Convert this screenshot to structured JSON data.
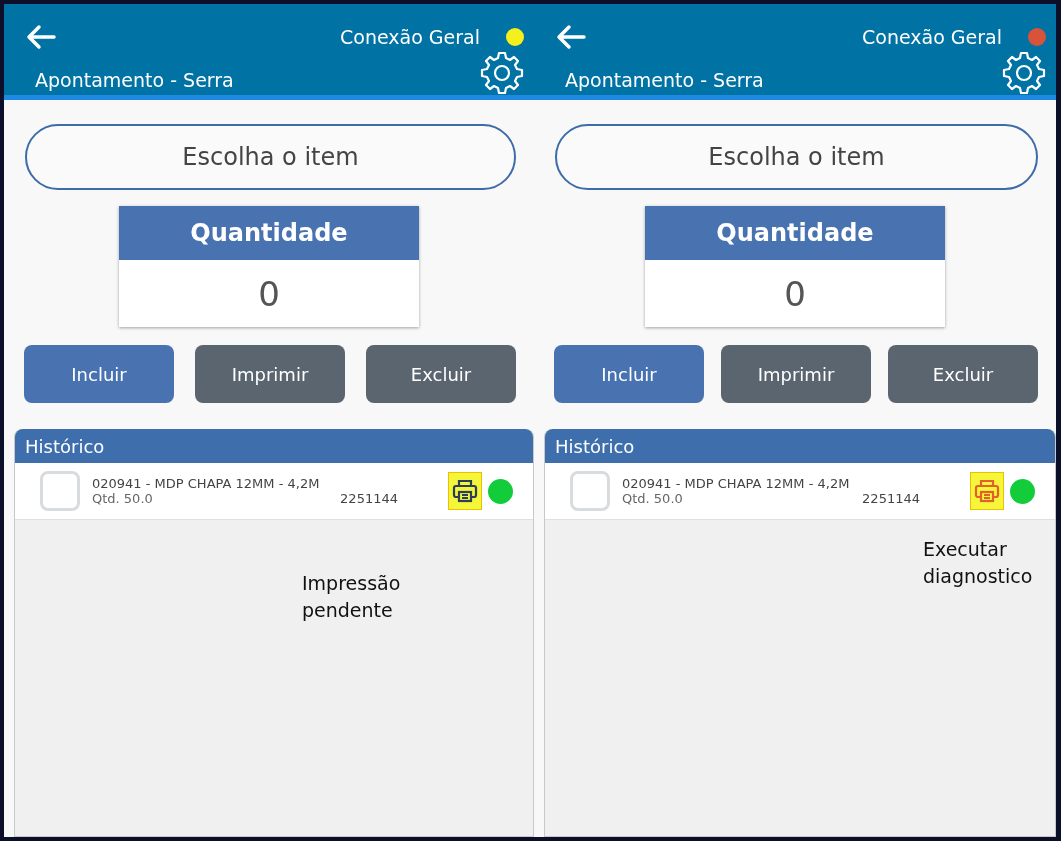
{
  "screens": [
    {
      "header": {
        "connection_label": "Conexão Geral",
        "connection_status": {
          "color": "#f5f01c"
        },
        "title": "Apontamento - Serra"
      },
      "item_picker": {
        "label": "Escolha o item"
      },
      "quantity": {
        "title": "Quantidade",
        "value": "0"
      },
      "buttons": [
        {
          "label": "Incluir",
          "kind": "primary"
        },
        {
          "label": "Imprimir",
          "kind": "secondary"
        },
        {
          "label": "Excluir",
          "kind": "secondary"
        }
      ],
      "history": {
        "title": "Histórico",
        "rows": [
          {
            "checked": false,
            "description": "020941 - MDP CHAPA 12MM - 4,2M",
            "quantity": "Qtd. 50.0",
            "number": "2251144",
            "printer": {
              "color": "#2c3e5a"
            },
            "status": {
              "color": "#13cc3a"
            }
          }
        ]
      },
      "note": "Impressão pendente"
    },
    {
      "header": {
        "connection_label": "Conexão Geral",
        "connection_status": {
          "color": "#d9533a"
        },
        "title": "Apontamento - Serra"
      },
      "item_picker": {
        "label": "Escolha o item"
      },
      "quantity": {
        "title": "Quantidade",
        "value": "0"
      },
      "buttons": [
        {
          "label": "Incluir",
          "kind": "primary"
        },
        {
          "label": "Imprimir",
          "kind": "secondary"
        },
        {
          "label": "Excluir",
          "kind": "secondary"
        }
      ],
      "history": {
        "title": "Histórico",
        "rows": [
          {
            "checked": false,
            "description": "020941 - MDP CHAPA 12MM - 4,2M",
            "quantity": "Qtd. 50.0",
            "number": "2251144",
            "printer": {
              "color": "#e0622a"
            },
            "status": {
              "color": "#13cc3a"
            }
          }
        ]
      },
      "note": "Executar diagnostico"
    }
  ]
}
